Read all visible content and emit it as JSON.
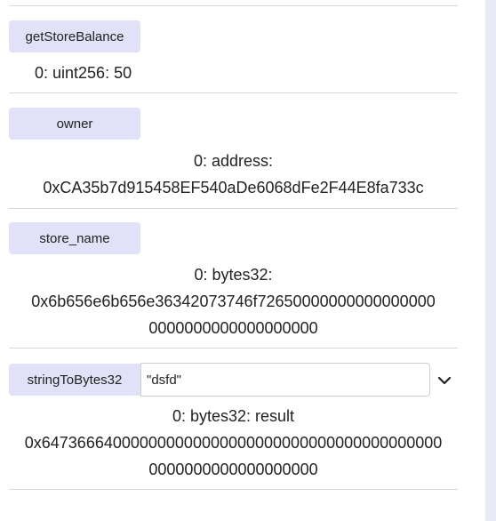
{
  "functions": [
    {
      "button_label": "getStoreBalance",
      "result_lines": [
        "0: uint256: 50"
      ]
    },
    {
      "button_label": "owner",
      "result_lines": [
        "0: address:",
        "0xCA35b7d915458EF540aDe6068dFe2F44E8fa733c"
      ]
    },
    {
      "button_label": "store_name",
      "result_lines": [
        "0: bytes32:",
        "0x6b656e6b656e36342073746f72650000000000000000",
        "0000000000000000000"
      ]
    },
    {
      "button_label": "stringToBytes32",
      "input_value": "\"dsfd\"",
      "result_lines": [
        "0: bytes32: result",
        "0x647366640000000000000000000000000000000000000",
        "0000000000000000000"
      ]
    }
  ],
  "icons": {
    "expand": "chevron-down-icon"
  },
  "colors": {
    "button_bg": "#e1e2f7",
    "text": "#222222",
    "divider": "#d9d9d9"
  }
}
